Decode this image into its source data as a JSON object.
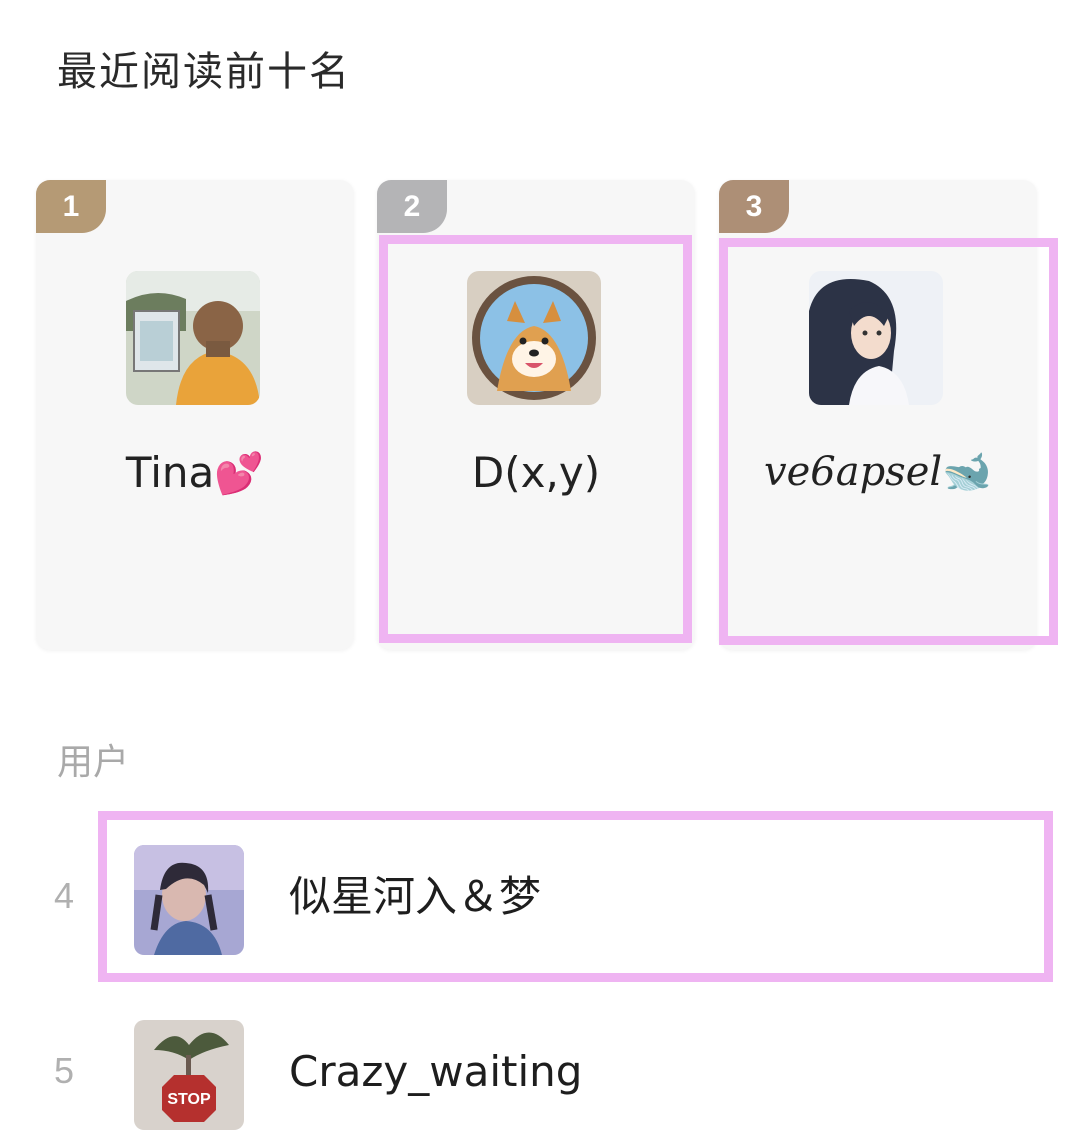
{
  "section": {
    "title": "最近阅读前十名"
  },
  "podium": [
    {
      "rank": "1",
      "name": "Tina",
      "emoji": "💕",
      "avatar": "girl-back-painting-avatar"
    },
    {
      "rank": "2",
      "name": "D(x,y)",
      "avatar": "shiba-dog-avatar"
    },
    {
      "rank": "3",
      "name": "ve6apsel",
      "emoji": "🐋",
      "avatar": "anime-girl-avatar"
    }
  ],
  "users": {
    "label": "用户",
    "items": [
      {
        "rank": "4",
        "name": "似星河入＆梦",
        "avatar": "girl-portrait-avatar"
      },
      {
        "rank": "5",
        "name": "Crazy_waiting",
        "avatar": "stop-sign-avatar"
      }
    ]
  },
  "colors": {
    "highlight": "#efb4f2",
    "gold": "#b59a75",
    "silver": "#b4b4b6",
    "bronze": "#ad8f76"
  }
}
